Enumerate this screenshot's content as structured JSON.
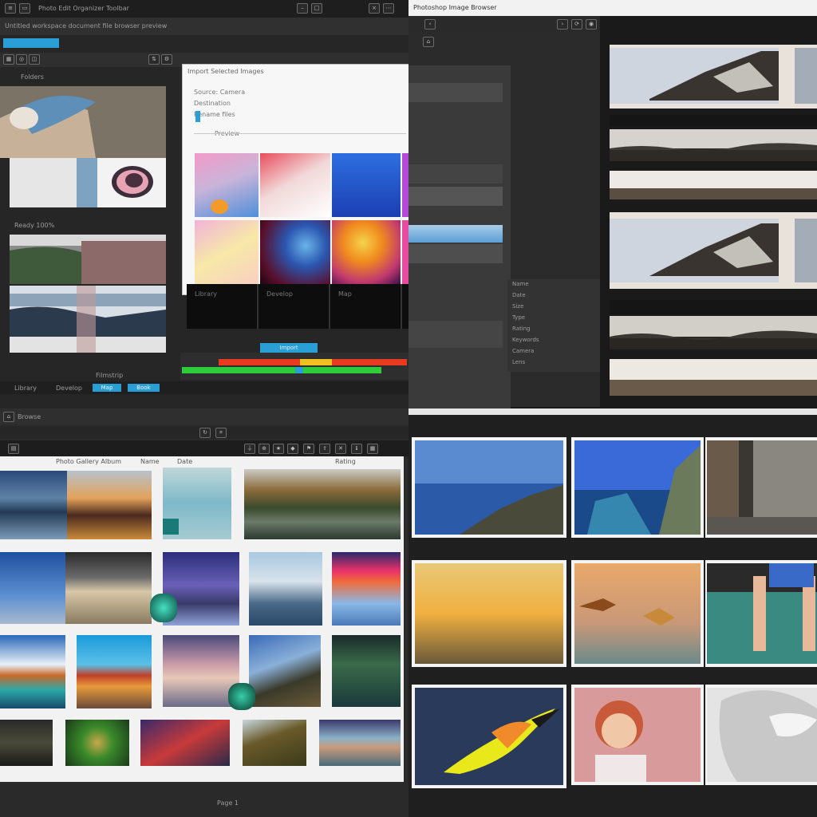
{
  "q1": {
    "toolbar_text": "Photo Edit Organizer Toolbar",
    "subtitle": "Untitled workspace document file browser preview",
    "panel_label": "Folders",
    "dialog_title": "Import Selected Images",
    "dialog_lines": [
      "Source: Camera",
      "Destination",
      "Rename files"
    ],
    "dialog_caption": "Preview",
    "primary_button": "Import",
    "status_left": "Ready  100%",
    "status_right": "Filmstrip",
    "bottom_tabs": [
      "Library",
      "Develop",
      "Map",
      "Book"
    ],
    "accent": "#2a9fd6"
  },
  "q2": {
    "window_title": "Photoshop Image Browser",
    "menu_items": [
      "Name",
      "Date",
      "Size",
      "Type",
      "Rating",
      "Keywords",
      "Camera",
      "Lens"
    ]
  },
  "q3": {
    "toolbar_label": "Browse",
    "header_text": "Photo Gallery Album",
    "columns": [
      "Name",
      "Date",
      "Rating"
    ],
    "footer_text": "Page 1"
  },
  "colors": {
    "bg": "#1b1b1b",
    "panel": "#2a2a2a",
    "frame": "#f4f4f4"
  }
}
